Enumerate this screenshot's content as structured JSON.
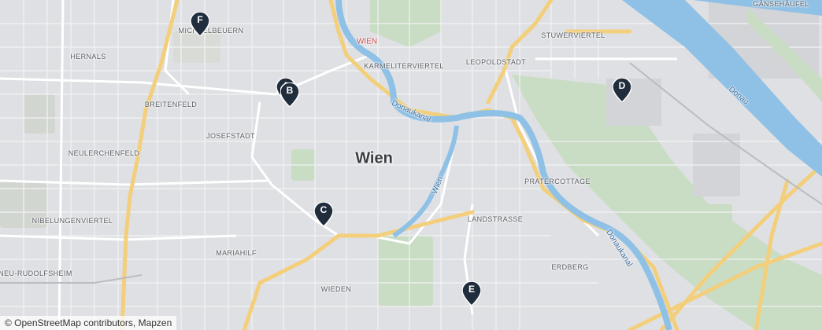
{
  "map": {
    "city": "Wien",
    "city_small": "WIEN",
    "districts": {
      "michaelbeuern": "MICHAELBEUERN",
      "hernals": "HERNALS",
      "stuwerviertel": "STUWERVIERTEL",
      "gaensehaeufel": "GÄNSEHÄUFEL",
      "karmeliterviertel": "KARMELITERVIERTEL",
      "leopoldstadt": "LEOPOLDSTADT",
      "breitenfeld": "BREITENFELD",
      "josefstadt": "JOSEFSTADT",
      "neulerchenfeld": "NEULERCHENFELD",
      "pratercottage": "PRATERCOTTAGE",
      "nibelungenviertel": "NIBELUNGENVIERTEL",
      "landstrasse": "LANDSTRASSE",
      "mariahilf": "MARIAHILF",
      "erdberg": "ERDBERG",
      "neu_rudolfsheim": "NEU-RUDOLFSHEIM",
      "wieden": "WIEDEN"
    },
    "water": {
      "donaukanal_1": "Donaukanal",
      "donaukanal_2": "Donaukanal",
      "wien_river": "Wien",
      "donau": "Donau"
    },
    "markers": [
      "A",
      "B",
      "C",
      "D",
      "E",
      "F"
    ],
    "attribution": "© OpenStreetMap contributors, Mapzen",
    "colors": {
      "land": "#dfe0e3",
      "park": "#c9dcc4",
      "water": "#8fc1e6",
      "major_road": "#f3cf7c",
      "minor_road": "#ffffff",
      "marker": "#1f2d3d"
    }
  }
}
